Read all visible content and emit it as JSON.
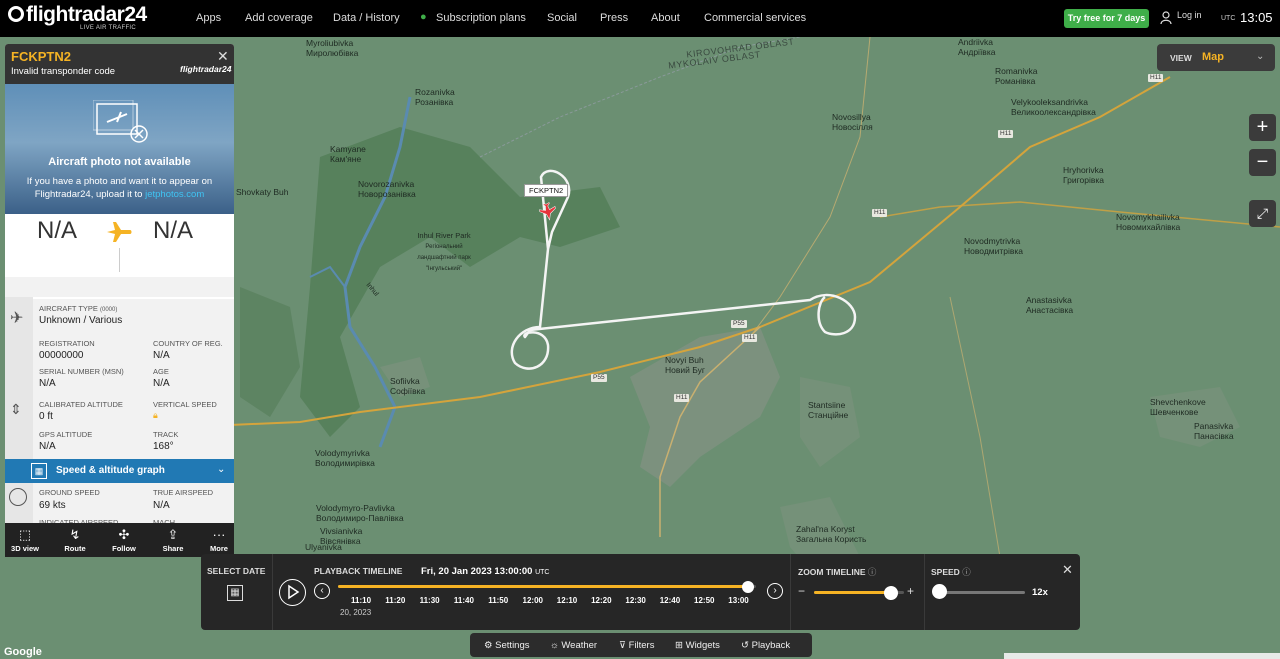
{
  "brand": {
    "name": "flightradar24",
    "tagline": "LIVE AIR TRAFFIC"
  },
  "nav": {
    "items": [
      "Apps",
      "Add coverage",
      "Data / History",
      "Subscription plans",
      "Social",
      "Press",
      "About",
      "Commercial services"
    ],
    "try_free": "Try free for 7 days",
    "login": "Log in",
    "utc_label": "UTC",
    "time": "13:05"
  },
  "view": {
    "label": "VIEW",
    "value": "Map"
  },
  "map": {
    "regions": [
      "KIROVOHRAD OBLAST",
      "MYKOLAIV OBLAST"
    ],
    "places": [
      {
        "lat": "Myroliubivka",
        "cyr": "Миролюбівка"
      },
      {
        "lat": "Rozanivka",
        "cyr": "Розанівка"
      },
      {
        "lat": "Kamyane",
        "cyr": "Кам'яне"
      },
      {
        "lat": "Novorozanivka",
        "cyr": "Новорозанівка"
      },
      {
        "lat": "Inhul River Park",
        "cyr": "Регіональний ландшафтний парк \"Інгульський\""
      },
      {
        "lat": "Sofiivka",
        "cyr": "Софіївка"
      },
      {
        "lat": "Novosillya",
        "cyr": "Новосілля"
      },
      {
        "lat": "Novyi Buh",
        "cyr": "Новий Буг"
      },
      {
        "lat": "Stantsiine",
        "cyr": "Станційне"
      },
      {
        "lat": "Volodymyrivka",
        "cyr": "Володимирівка"
      },
      {
        "lat": "Volodymyro-Pavlivka",
        "cyr": "Володимиро-Павлівка"
      },
      {
        "lat": "Vivsianivka",
        "cyr": "Вівсянівка"
      },
      {
        "lat": "Zahal'na Koryst",
        "cyr": "Загальна Користь"
      },
      {
        "lat": "Andriivka",
        "cyr": "Андріївка"
      },
      {
        "lat": "Romanivka",
        "cyr": "Романівка"
      },
      {
        "lat": "Velykooleksandrivka",
        "cyr": "Великоолександрівка"
      },
      {
        "lat": "Hryhorivka",
        "cyr": "Григорівка"
      },
      {
        "lat": "Novomykhailivka",
        "cyr": "Новомихайлівка"
      },
      {
        "lat": "Novodmytrivka",
        "cyr": "Новодмитрівка"
      },
      {
        "lat": "Anastasivka",
        "cyr": "Анастасівка"
      },
      {
        "lat": "Shevchenkove",
        "cyr": "Шевченкове"
      },
      {
        "lat": "Panasivka",
        "cyr": "Панасівка"
      },
      {
        "lat": "Ulyanivka",
        "cyr": ""
      },
      {
        "lat": "Shovkaty Buh",
        "cyr": ""
      }
    ],
    "roads": [
      "H11",
      "P55",
      "H11",
      "P55",
      "H11",
      "H11",
      "H11"
    ],
    "aircraft_label": "FCKPTN2",
    "river_label": "Inhul"
  },
  "aircraft": {
    "callsign": "FCKPTN2",
    "subtitle": "Invalid transponder code",
    "panel_logo": "flightradar24",
    "photo_title": "Aircraft photo not available",
    "photo_text": "If you have a photo and want it to appear on Flightradar24, upload it to",
    "photo_link": "jetphotos.com",
    "origin": "N/A",
    "destination": "N/A",
    "aircraft_type_label": "AIRCRAFT TYPE",
    "aircraft_type_code": "(0000)",
    "aircraft_type": "Unknown / Various",
    "registration_label": "REGISTRATION",
    "registration": "00000000",
    "country_label": "COUNTRY OF REG.",
    "country": "N/A",
    "serial_label": "SERIAL NUMBER (MSN)",
    "serial": "N/A",
    "age_label": "AGE",
    "age": "N/A",
    "cal_alt_label": "CALIBRATED ALTITUDE",
    "cal_alt": "0 ft",
    "vs_label": "VERTICAL SPEED",
    "gps_alt_label": "GPS ALTITUDE",
    "gps_alt": "N/A",
    "track_label": "TRACK",
    "track": "168°",
    "graph_label": "Speed & altitude graph",
    "ground_speed_label": "GROUND SPEED",
    "ground_speed": "69 kts",
    "tas_label": "TRUE AIRSPEED",
    "tas": "N/A",
    "ias_label": "INDICATED AIRSPEED",
    "mach_label": "MACH"
  },
  "panel_footer": [
    "3D view",
    "Route",
    "Follow",
    "Share",
    "More"
  ],
  "playback": {
    "select_date": "SELECT DATE",
    "timeline_label": "PLAYBACK TIMELINE",
    "current": "Fri, 20 Jan 2023 13:00:00",
    "current_tz": "UTC",
    "ticks": [
      "11:10",
      "11:20",
      "11:30",
      "11:40",
      "11:50",
      "12:00",
      "12:10",
      "12:20",
      "12:30",
      "12:40",
      "12:50",
      "13:00"
    ],
    "tick_date": "20, 2023",
    "zoom_label": "ZOOM TIMELINE",
    "speed_label": "SPEED",
    "speed_value": "12x",
    "timeline_position": 0.98,
    "zoom_position": 0.85,
    "speed_position": 0.0
  },
  "toolbar": [
    "Settings",
    "Weather",
    "Filters",
    "Widgets",
    "Playback"
  ],
  "colors": {
    "accent": "#f5b324",
    "header_bg": "#000000",
    "panel_blue": "#2179b4",
    "map_green": "#6b8f72",
    "try_green": "#3fae49",
    "aircraft_red": "#e8333b"
  }
}
